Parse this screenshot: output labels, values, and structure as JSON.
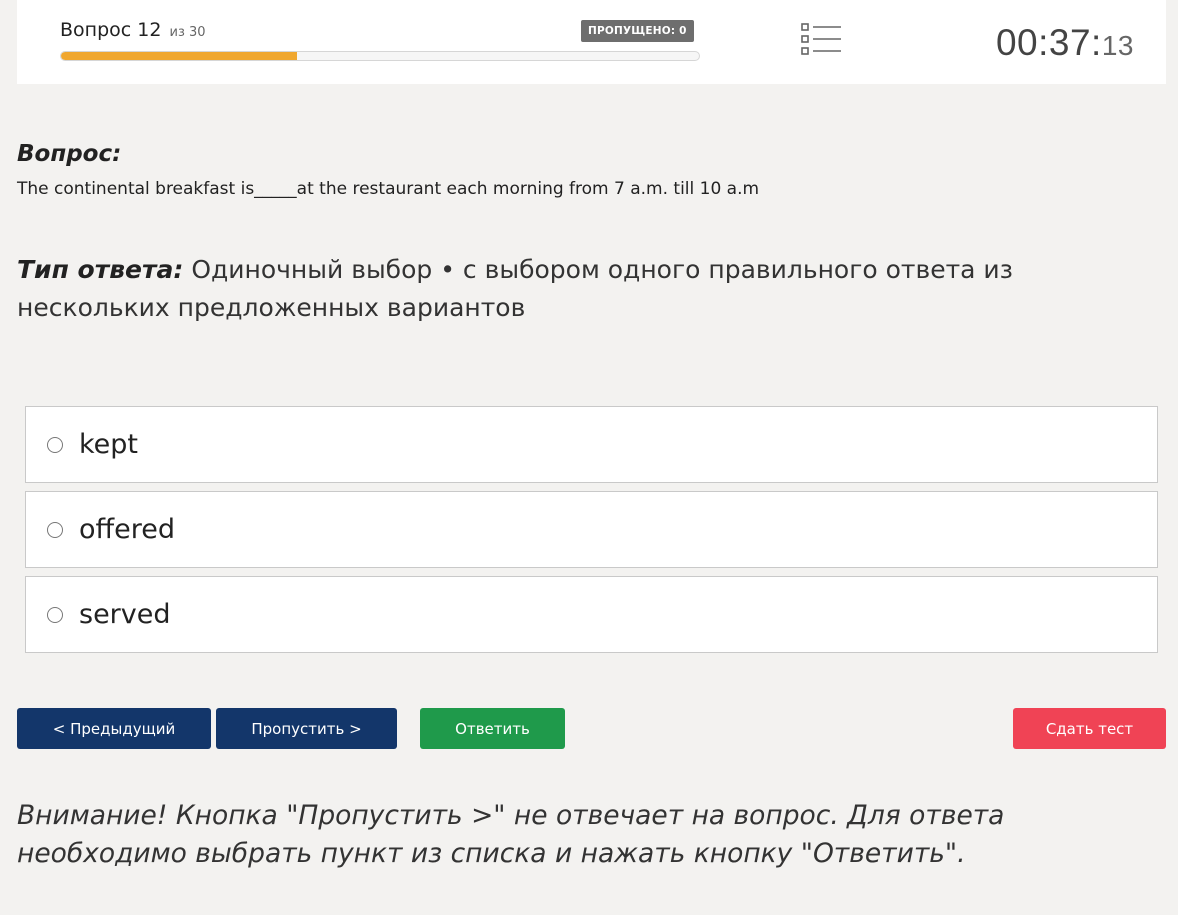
{
  "header": {
    "question_word": "Вопрос",
    "question_number": "12",
    "of_total": "из 30",
    "progress_fraction": 0.37,
    "skipped_badge": "ПРОПУЩЕНО: 0",
    "timer_main": "00:37:",
    "timer_seconds": "13"
  },
  "question": {
    "label": "Вопрос:",
    "text": "The continental breakfast is_____at the restaurant each morning from 7 a.m. till 10 a.m"
  },
  "answer_type": {
    "label": "Тип ответа:",
    "text": "Одиночный выбор • с выбором одного правильного ответа из нескольких предложенных вариантов"
  },
  "options": [
    {
      "label": "kept",
      "selected": false
    },
    {
      "label": "offered",
      "selected": false
    },
    {
      "label": "served",
      "selected": false
    }
  ],
  "buttons": {
    "prev": "< Предыдущий",
    "skip": "Пропустить >",
    "answer": "Ответить",
    "submit": "Сдать тест"
  },
  "warning": "Внимание! Кнопка \"Пропустить >\" не отвечает на вопрос. Для ответа необходимо выбрать пункт из списка и нажать кнопку \"Ответить\".",
  "colors": {
    "progress": "#f0a72f",
    "primary_button": "#13366a",
    "answer_button": "#1f9a4b",
    "submit_button": "#f04355",
    "badge": "#6e6e6e"
  },
  "icons": {
    "question_list": "list-icon",
    "radio": "radio-unchecked-icon"
  }
}
